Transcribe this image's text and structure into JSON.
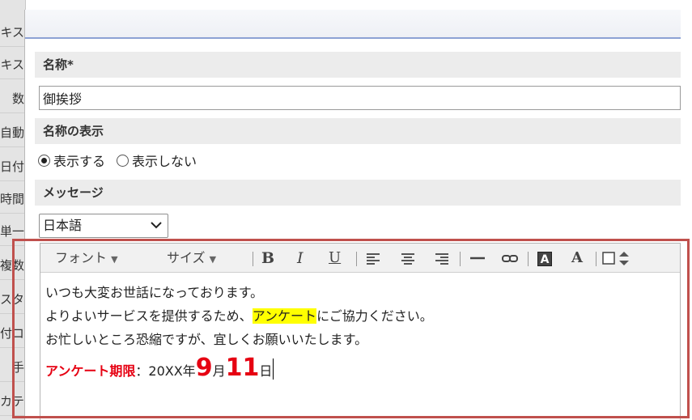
{
  "background": {
    "fragments": [
      "キス",
      "キス",
      "数",
      "自動",
      "日付",
      "時間",
      "単一",
      "複数",
      "スタ",
      "付コ",
      "手",
      "カテ"
    ]
  },
  "form": {
    "name_section_label": "名称*",
    "name_value": "御挨拶",
    "display_section_label": "名称の表示",
    "radio_show": "表示する",
    "radio_hide": "表示しない",
    "message_section_label": "メッセージ",
    "language_selected": "日本語"
  },
  "toolbar": {
    "font_label": "フォント",
    "size_label": "サイズ",
    "bold": "B",
    "italic": "I",
    "underline": "U",
    "bg_color": "A",
    "text_color": "A"
  },
  "editor": {
    "line1": "いつも大変お世話になっております。",
    "line2_before": "よりよいサービスを提供するため、",
    "line2_highlight": "アンケート",
    "line2_after": "にご協力ください。",
    "line3": "お忙しいところ恐縮ですが、宜しくお願いいたします。",
    "deadline_label": "アンケート期限",
    "deadline_colon": "：",
    "deadline_year": "20XX年",
    "deadline_month": "9",
    "month_unit": "月",
    "deadline_day": "11",
    "day_unit": "日"
  },
  "colors": {
    "annotation_frame": "#c0504d",
    "deadline_red": "#e60012",
    "highlight": "#ffff00",
    "title_bar_border": "#8da2d4"
  }
}
